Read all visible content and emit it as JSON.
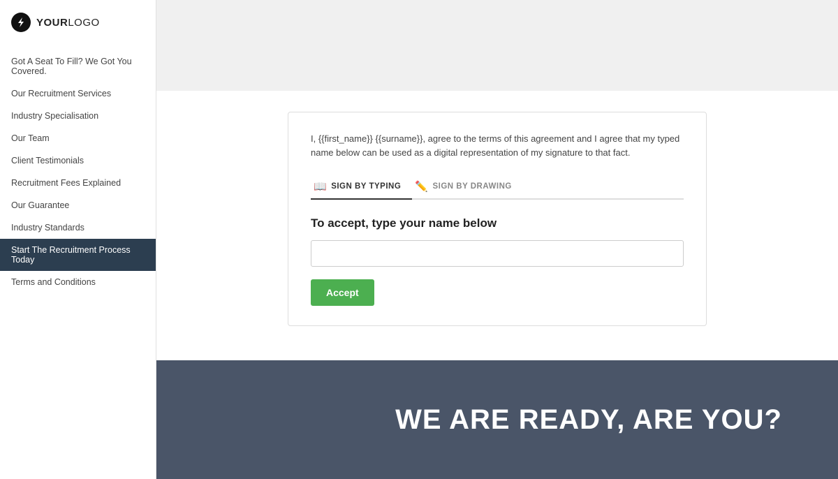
{
  "logo": {
    "icon_alt": "bolt-icon",
    "text_bold": "YOUR",
    "text_regular": "LOGO"
  },
  "sidebar": {
    "items": [
      {
        "label": "Got A Seat To Fill? We Got You Covered.",
        "active": false
      },
      {
        "label": "Our Recruitment Services",
        "active": false
      },
      {
        "label": "Industry Specialisation",
        "active": false
      },
      {
        "label": "Our Team",
        "active": false
      },
      {
        "label": "Client Testimonials",
        "active": false
      },
      {
        "label": "Recruitment Fees Explained",
        "active": false
      },
      {
        "label": "Our Guarantee",
        "active": false
      },
      {
        "label": "Industry Standards",
        "active": false
      },
      {
        "label": "Start The Recruitment Process Today",
        "active": true
      },
      {
        "label": "Terms and Conditions",
        "active": false
      }
    ]
  },
  "signature_card": {
    "agreement_text": "I, {{first_name}} {{surname}}, agree to the terms of this agreement and I agree that my typed name below can be used as a digital representation of my signature to that fact.",
    "tab_typing_label": "SIGN BY TYPING",
    "tab_drawing_label": "SIGN BY DRAWING",
    "accept_label": "To accept, type your name below",
    "name_input_placeholder": "",
    "accept_button_label": "Accept"
  },
  "footer": {
    "heading": "WE ARE READY, ARE YOU?"
  }
}
